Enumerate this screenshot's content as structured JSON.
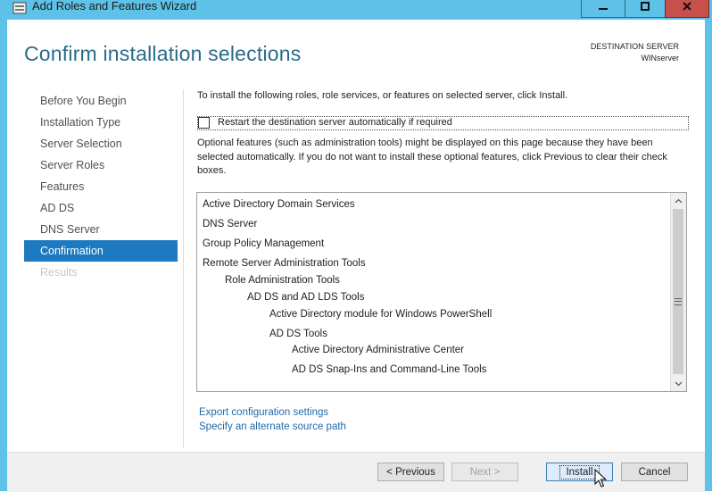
{
  "window": {
    "title": "Add Roles and Features Wizard",
    "icons": {
      "app": "server-manager-icon",
      "minimize": "minimize-icon",
      "maximize": "maximize-icon",
      "close": "close-icon"
    }
  },
  "header": {
    "page_title": "Confirm installation selections",
    "destination_label": "DESTINATION SERVER",
    "destination_server": "WINserver"
  },
  "nav": {
    "items": [
      {
        "label": "Before You Begin",
        "state": "normal"
      },
      {
        "label": "Installation Type",
        "state": "normal"
      },
      {
        "label": "Server Selection",
        "state": "normal"
      },
      {
        "label": "Server Roles",
        "state": "normal"
      },
      {
        "label": "Features",
        "state": "normal"
      },
      {
        "label": "AD DS",
        "state": "normal"
      },
      {
        "label": "DNS Server",
        "state": "normal"
      },
      {
        "label": "Confirmation",
        "state": "active"
      },
      {
        "label": "Results",
        "state": "disabled"
      }
    ]
  },
  "content": {
    "intro": "To install the following roles, role services, or features on selected server, click Install.",
    "restart_label": "Restart the destination server automatically if required",
    "restart_checked": false,
    "optional_note": "Optional features (such as administration tools) might be displayed on this page because they have been selected automatically. If you do not want to install these optional features, click Previous to clear their check boxes.",
    "selections": [
      {
        "label": "Active Directory Domain Services",
        "level": 0
      },
      {
        "label": "DNS Server",
        "level": 0
      },
      {
        "label": "Group Policy Management",
        "level": 0
      },
      {
        "label": "Remote Server Administration Tools",
        "level": 0
      },
      {
        "label": "Role Administration Tools",
        "level": 1
      },
      {
        "label": "AD DS and AD LDS Tools",
        "level": 2
      },
      {
        "label": "Active Directory module for Windows PowerShell",
        "level": 3
      },
      {
        "label": "AD DS Tools",
        "level": 3
      },
      {
        "label": "Active Directory Administrative Center",
        "level": 4
      },
      {
        "label": "AD DS Snap-Ins and Command-Line Tools",
        "level": 4
      }
    ],
    "links": {
      "export": "Export configuration settings",
      "alternate_source": "Specify an alternate source path"
    }
  },
  "footer": {
    "previous": "< Previous",
    "next": "Next >",
    "install": "Install",
    "cancel": "Cancel"
  },
  "colors": {
    "titlebar": "#5ec2e8",
    "accent": "#1d7ac0",
    "title_text": "#2a6b8a",
    "link": "#1e6aa8",
    "close": "#c7504d"
  }
}
